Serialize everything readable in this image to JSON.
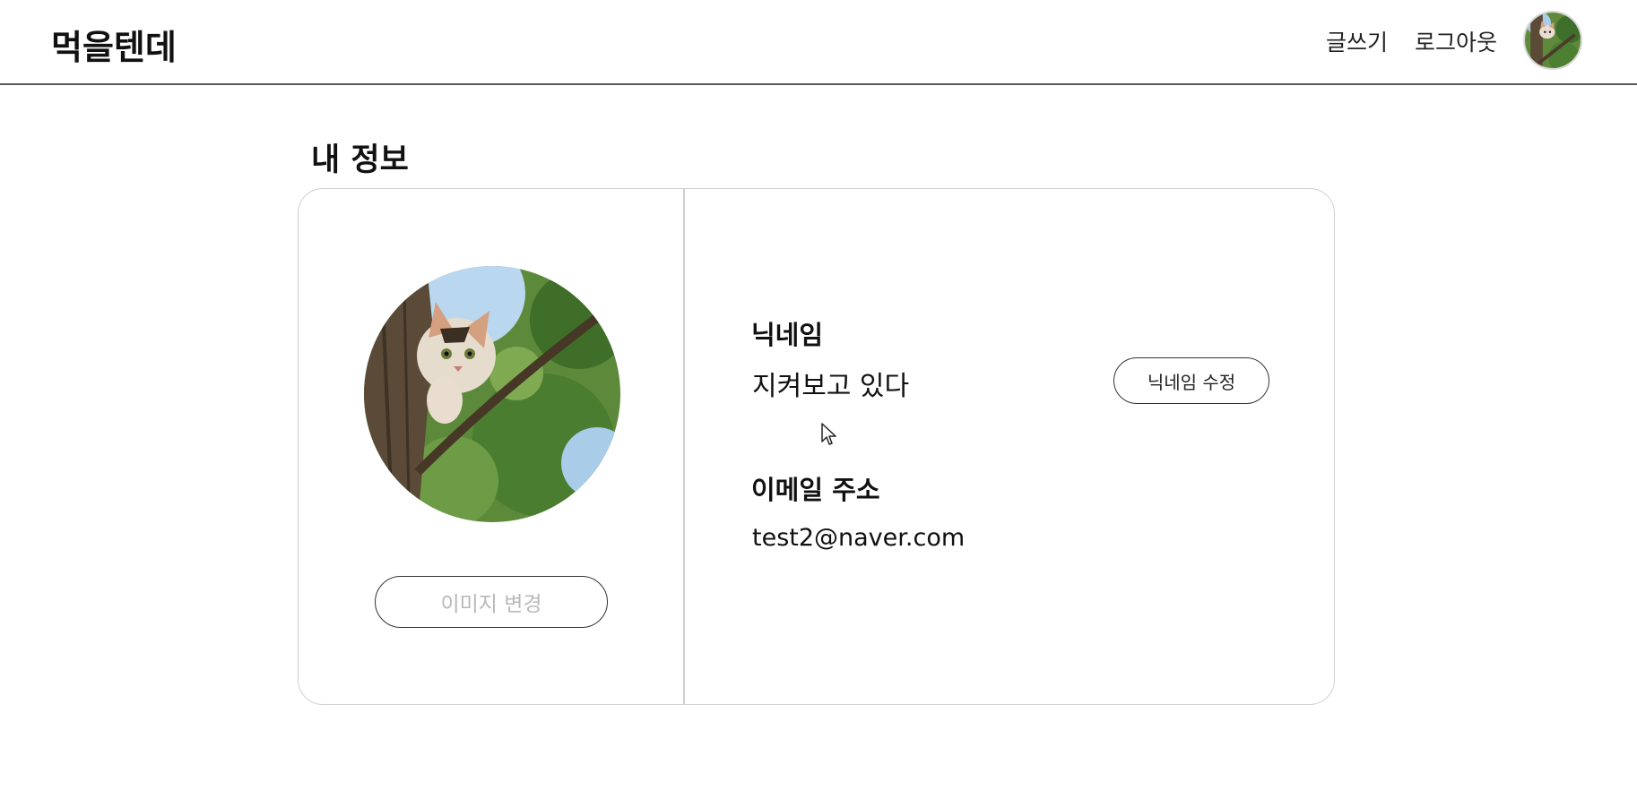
{
  "header": {
    "logo": "먹을텐데",
    "write_label": "글쓰기",
    "logout_label": "로그아웃",
    "avatar_icon": "profile-avatar-icon"
  },
  "page": {
    "title": "내 정보"
  },
  "profile": {
    "image_icon": "cat-profile-photo",
    "change_image_label": "이미지 변경",
    "nickname_label": "닉네임",
    "nickname_value": "지켜보고 있다",
    "edit_nickname_label": "닉네임 수정",
    "email_label": "이메일 주소",
    "email_value": "test2@naver.com"
  },
  "colors": {
    "border": "#cfcfcf",
    "text": "#111111",
    "muted": "#b9b9b9"
  }
}
